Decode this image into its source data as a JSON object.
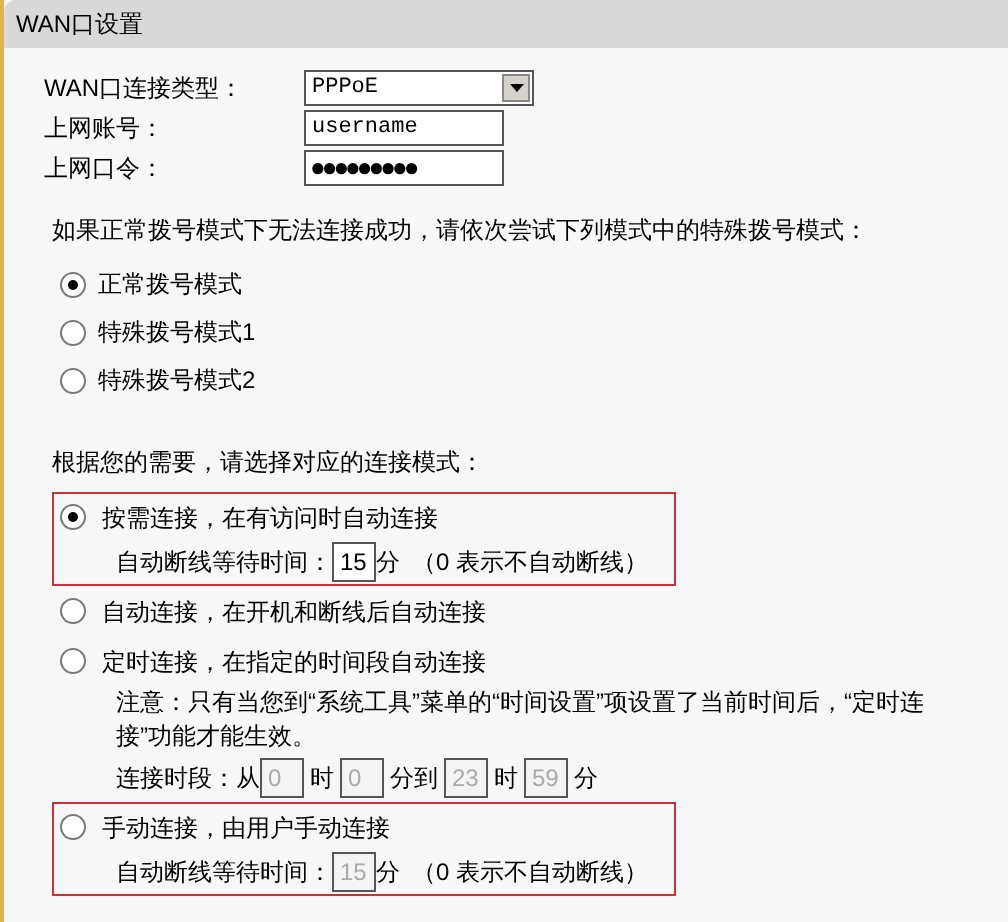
{
  "panel": {
    "title": "WAN口设置"
  },
  "fields": [
    {
      "kind": "select",
      "label": "WAN口连接类型：",
      "value": "PPPoE"
    },
    {
      "kind": "text",
      "label": "上网账号：",
      "value": "username"
    },
    {
      "kind": "password",
      "label": "上网口令：",
      "value": "●●●●●●●●●"
    }
  ],
  "dial_prompt": "如果正常拨号模式下无法连接成功，请依次尝试下列模式中的特殊拨号模式：",
  "dial_modes": [
    {
      "label": "正常拨号模式",
      "selected": true
    },
    {
      "label": "特殊拨号模式1",
      "selected": false
    },
    {
      "label": "特殊拨号模式2",
      "selected": false
    }
  ],
  "connect_prompt": "根据您的需要，请选择对应的连接模式：",
  "connect_modes": [
    {
      "kind": "idle",
      "label": "按需连接，在有访问时自动连接",
      "selected": true,
      "highlighted": true,
      "disabled": false,
      "idle_label": "自动断线等待时间：",
      "value": "15",
      "unit": "分",
      "hint": "（0 表示不自动断线）"
    },
    {
      "kind": "plain",
      "label": "自动连接，在开机和断线后自动连接",
      "selected": false,
      "highlighted": false
    },
    {
      "kind": "timed",
      "label": "定时连接，在指定的时间段自动连接",
      "selected": false,
      "highlighted": false,
      "disabled": true,
      "note": "注意：只有当您到“系统工具”菜单的“时间设置”项设置了当前时间后，“定时连接”功能才能生效。",
      "range_label": "连接时段：从",
      "times": [
        {
          "value": "0",
          "unit": "时"
        },
        {
          "value": "0",
          "unit": "分到"
        },
        {
          "value": "23",
          "unit": "时"
        },
        {
          "value": "59",
          "unit": "分"
        }
      ]
    },
    {
      "kind": "idle",
      "label": "手动连接，由用户手动连接",
      "selected": false,
      "highlighted": true,
      "disabled": true,
      "idle_label": "自动断线等待时间：",
      "value": "15",
      "unit": "分",
      "hint": "（0 表示不自动断线）"
    }
  ]
}
